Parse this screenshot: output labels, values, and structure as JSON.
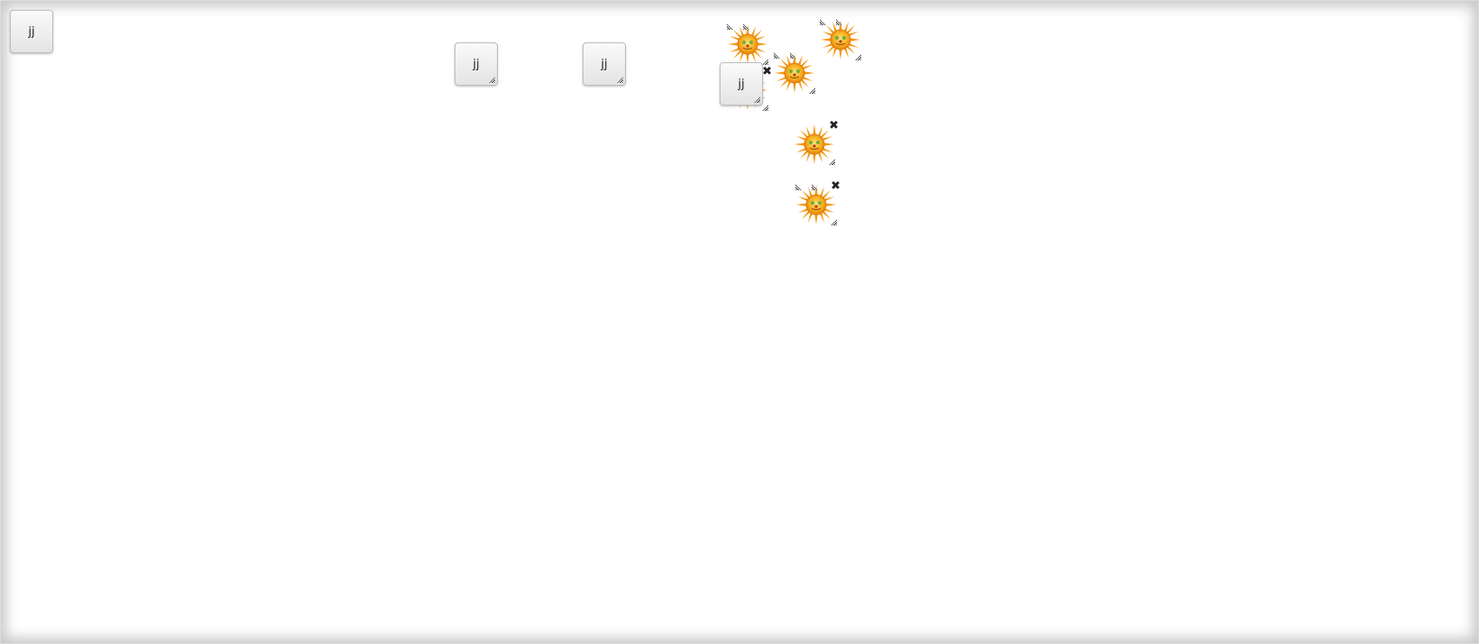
{
  "widgets": {
    "button_label": "jj",
    "close_glyph": "✖",
    "image_icon": "sun-icon"
  },
  "colors": {
    "canvas_bg": "#ffffff",
    "frame": "#dcdcdc",
    "sun_outer": "#f7a21b",
    "sun_inner": "#f5c518"
  }
}
